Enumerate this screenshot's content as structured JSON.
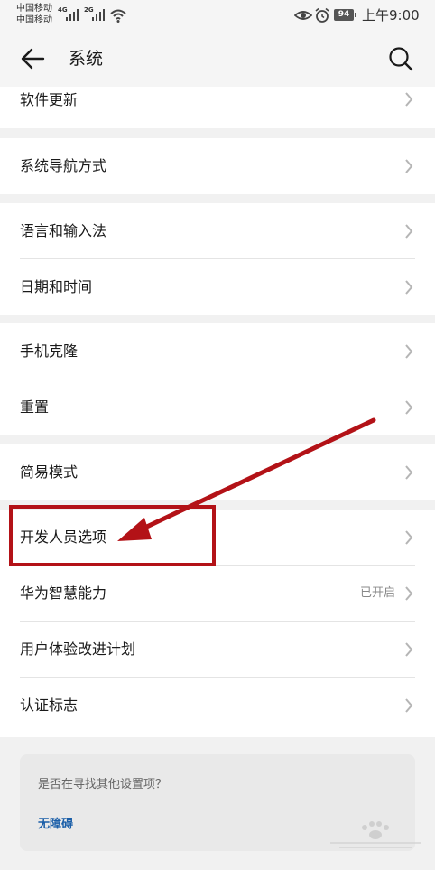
{
  "status_bar": {
    "carrier1": "中国移动",
    "carrier2": "中国移动",
    "net1": "4G",
    "net2": "2G",
    "battery": "94",
    "time": "上午9:00"
  },
  "header": {
    "title": "系统"
  },
  "groups": [
    {
      "items": [
        {
          "label": "软件更新",
          "value": ""
        }
      ]
    },
    {
      "items": [
        {
          "label": "系统导航方式",
          "value": ""
        }
      ]
    },
    {
      "items": [
        {
          "label": "语言和输入法",
          "value": ""
        },
        {
          "label": "日期和时间",
          "value": ""
        }
      ]
    },
    {
      "items": [
        {
          "label": "手机克隆",
          "value": ""
        },
        {
          "label": "重置",
          "value": ""
        }
      ]
    },
    {
      "items": [
        {
          "label": "简易模式",
          "value": ""
        }
      ]
    },
    {
      "items": [
        {
          "label": "开发人员选项",
          "value": ""
        },
        {
          "label": "华为智慧能力",
          "value": "已开启"
        },
        {
          "label": "用户体验改进计划",
          "value": ""
        },
        {
          "label": "认证标志",
          "value": ""
        }
      ]
    }
  ],
  "suggestion_card": {
    "question": "是否在寻找其他设置项？",
    "link": "无障碍"
  },
  "colors": {
    "accent_link": "#1a5ea8",
    "annotation_red": "#b31217"
  }
}
